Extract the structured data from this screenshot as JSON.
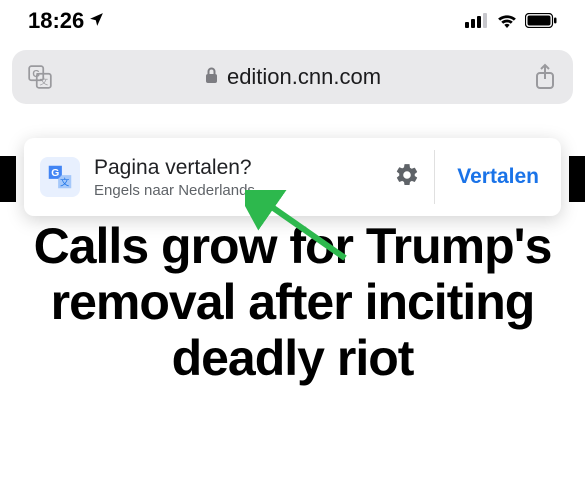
{
  "status": {
    "time": "18:26"
  },
  "url_bar": {
    "domain": "edition.cnn.com"
  },
  "translate": {
    "title": "Pagina vertalen?",
    "subtitle": "Engels naar Nederlands",
    "action": "Vertalen"
  },
  "article": {
    "headline": "Calls grow for Trump's removal after inciting deadly riot"
  }
}
